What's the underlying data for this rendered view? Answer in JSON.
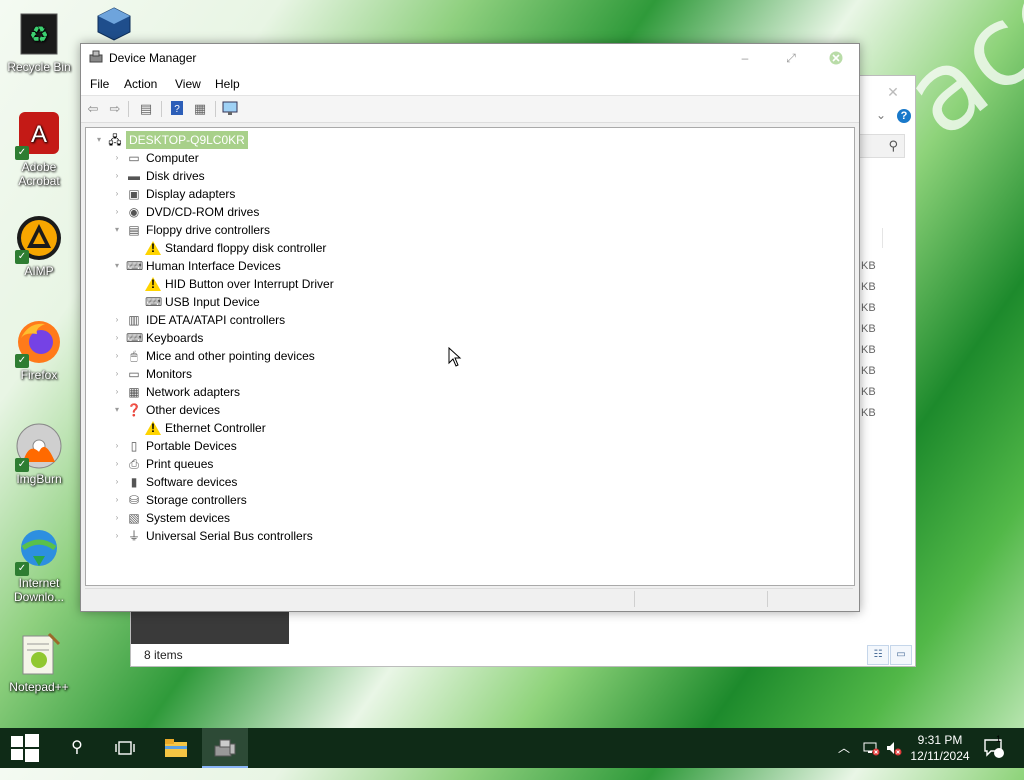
{
  "desktop": {
    "icons": [
      {
        "name": "recycle-bin-icon",
        "label": "Recycle Bin"
      },
      {
        "name": "adobe-acrobat-icon",
        "label": "Adobe Acrobat"
      },
      {
        "name": "aimp-icon",
        "label": "AIMP"
      },
      {
        "name": "firefox-icon",
        "label": "Firefox"
      },
      {
        "name": "imgburn-icon",
        "label": "ImgBurn"
      },
      {
        "name": "internet-download-icon",
        "label": "Internet Downlo..."
      },
      {
        "name": "notepadpp-icon",
        "label": "Notepad++"
      }
    ],
    "wallpaper_text": "ace"
  },
  "bg_window": {
    "kb_values": [
      "KB",
      "KB",
      "KB",
      "KB",
      "KB",
      "KB",
      "KB",
      "KB"
    ],
    "status": "8 items"
  },
  "device_manager": {
    "title": "Device Manager",
    "menu": [
      "File",
      "Action",
      "View",
      "Help"
    ],
    "root": "DESKTOP-Q9LC0KR",
    "tree": [
      {
        "label": "Computer",
        "level": 1,
        "expanded": false
      },
      {
        "label": "Disk drives",
        "level": 1,
        "expanded": false
      },
      {
        "label": "Display adapters",
        "level": 1,
        "expanded": false
      },
      {
        "label": "DVD/CD-ROM drives",
        "level": 1,
        "expanded": false
      },
      {
        "label": "Floppy drive controllers",
        "level": 1,
        "expanded": true
      },
      {
        "label": "Standard floppy disk controller",
        "level": 2,
        "warning": true
      },
      {
        "label": "Human Interface Devices",
        "level": 1,
        "expanded": true
      },
      {
        "label": "HID Button over Interrupt Driver",
        "level": 2,
        "warning": true
      },
      {
        "label": "USB Input Device",
        "level": 2
      },
      {
        "label": "IDE ATA/ATAPI controllers",
        "level": 1,
        "expanded": false
      },
      {
        "label": "Keyboards",
        "level": 1,
        "expanded": false
      },
      {
        "label": "Mice and other pointing devices",
        "level": 1,
        "expanded": false
      },
      {
        "label": "Monitors",
        "level": 1,
        "expanded": false
      },
      {
        "label": "Network adapters",
        "level": 1,
        "expanded": false
      },
      {
        "label": "Other devices",
        "level": 1,
        "expanded": true
      },
      {
        "label": "Ethernet Controller",
        "level": 2,
        "warning": true
      },
      {
        "label": "Portable Devices",
        "level": 1,
        "expanded": false
      },
      {
        "label": "Print queues",
        "level": 1,
        "expanded": false
      },
      {
        "label": "Software devices",
        "level": 1,
        "expanded": false
      },
      {
        "label": "Storage controllers",
        "level": 1,
        "expanded": false
      },
      {
        "label": "System devices",
        "level": 1,
        "expanded": false
      },
      {
        "label": "Universal Serial Bus controllers",
        "level": 1,
        "expanded": false
      }
    ]
  },
  "taskbar": {
    "time": "9:31 PM",
    "date": "12/11/2024",
    "notification_count": "1"
  }
}
